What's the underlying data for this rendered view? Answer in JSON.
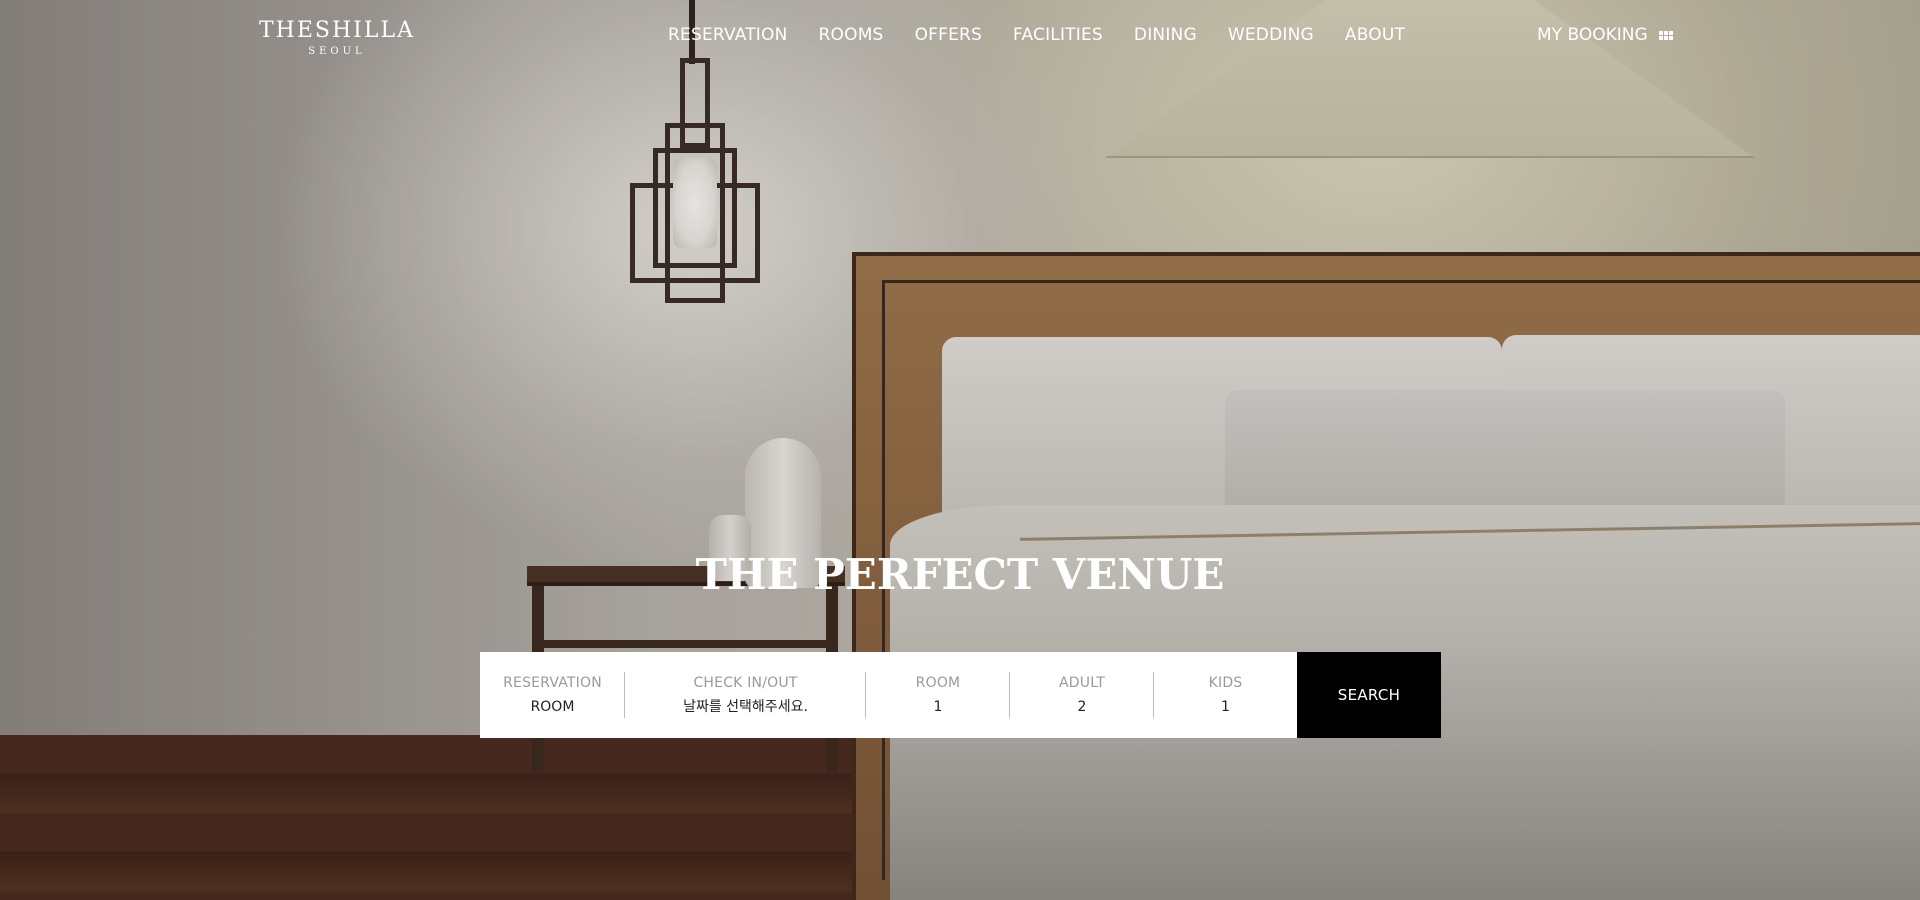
{
  "brand": {
    "name": "THESHILLA",
    "city": "SEOUL"
  },
  "nav": {
    "items": [
      {
        "label": "RESERVATION"
      },
      {
        "label": "ROOMS"
      },
      {
        "label": "OFFERS"
      },
      {
        "label": "FACILITIES"
      },
      {
        "label": "DINING"
      },
      {
        "label": "WEDDING"
      },
      {
        "label": "ABOUT"
      }
    ],
    "my_booking": "MY BOOKING",
    "menu_icon": "grid-icon"
  },
  "hero": {
    "headline": "THE PERFECT VENUE"
  },
  "booking": {
    "reservation": {
      "label": "RESERVATION",
      "value": "ROOM"
    },
    "check": {
      "label": "CHECK IN/OUT",
      "value": "날짜를 선택해주세요."
    },
    "room": {
      "label": "ROOM",
      "value": "1"
    },
    "adult": {
      "label": "ADULT",
      "value": "2"
    },
    "kids": {
      "label": "KIDS",
      "value": "1"
    },
    "search_label": "SEARCH"
  },
  "colors": {
    "search_button": "#000000",
    "booking_bar": "#ffffff",
    "field_label": "#9a9a9a"
  }
}
